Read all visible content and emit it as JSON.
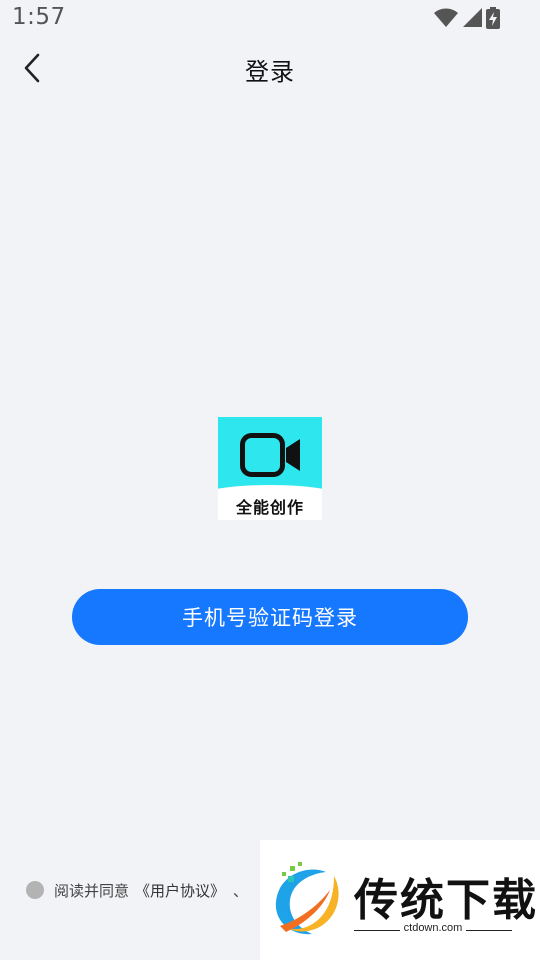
{
  "status_bar": {
    "time": "1:57",
    "icons": [
      "wifi-icon",
      "cell-signal-icon",
      "battery-charging-icon"
    ]
  },
  "header": {
    "title": "登录",
    "back_icon": "chevron-left-icon"
  },
  "logo": {
    "text": "全能创作",
    "icon": "video-camera-icon",
    "colors": {
      "top": "#2ee6ee",
      "bottom": "#ffffff",
      "mark": "#111111"
    }
  },
  "login_button": {
    "label": "手机号验证码登录",
    "color": "#1677ff"
  },
  "agreement": {
    "prefix": "阅读并同意",
    "link_user_agreement": "《用户协议》",
    "separator": "、"
  },
  "watermark": {
    "title": "传统下载",
    "subtitle": "ctdown.com"
  }
}
